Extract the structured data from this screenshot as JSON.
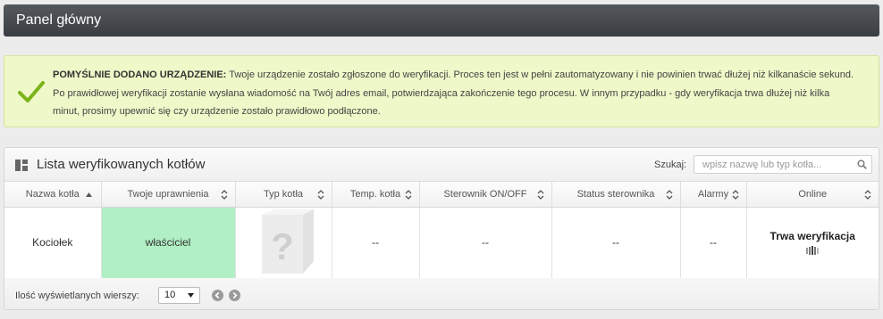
{
  "header": {
    "title": "Panel główny"
  },
  "alert": {
    "type": "success",
    "icon": "check-icon",
    "lead": "POMYŚLNIE DODANO URZĄDZENIE:",
    "message": "Twoje urządzenie zostało zgłoszone do weryfikacji. Proces ten jest w pełni zautomatyzowany i nie powinien trwać dłużej niż kilkanaście sekund.",
    "line2": "Po prawidłowej weryfikacji zostanie wysłana wiadomość na Twój adres email, potwierdzająca zakończenie tego procesu. W innym przypadku - gdy weryfikacja trwa dłużej niż kilka",
    "line3": "minut, prosimy upewnić się czy urządzenie zostało prawidłowo podłączone."
  },
  "panel": {
    "title": "Lista weryfikowanych kotłów",
    "search_label": "Szukaj:",
    "search_placeholder": "wpisz nazwę lub typ kotła..."
  },
  "table": {
    "columns": [
      {
        "label": "Nazwa kotła",
        "sort": "asc"
      },
      {
        "label": "Twoje uprawnienia",
        "sort": "both"
      },
      {
        "label": "Typ kotła",
        "sort": "both"
      },
      {
        "label": "Temp. kotła",
        "sort": "both"
      },
      {
        "label": "Sterownik ON/OFF",
        "sort": "both"
      },
      {
        "label": "Status sterownika",
        "sort": "both"
      },
      {
        "label": "Alarmy",
        "sort": "both"
      },
      {
        "label": "Online",
        "sort": "both"
      }
    ],
    "rows": [
      {
        "name": "Kociołek",
        "permission": "właściciel",
        "type_icon": "unknown-boiler-icon",
        "temp": "--",
        "onoff": "--",
        "status": "--",
        "alarms": "--",
        "online": "Trwa weryfikacja"
      }
    ]
  },
  "footer": {
    "rows_label": "Ilość wyświetlanych wierszy:",
    "rows_value": "10"
  },
  "colors": {
    "header_bg": "#3f4247",
    "alert_bg": "#eef8c8",
    "permission_bg": "#b0f0c4",
    "check_green": "#7ab317"
  }
}
